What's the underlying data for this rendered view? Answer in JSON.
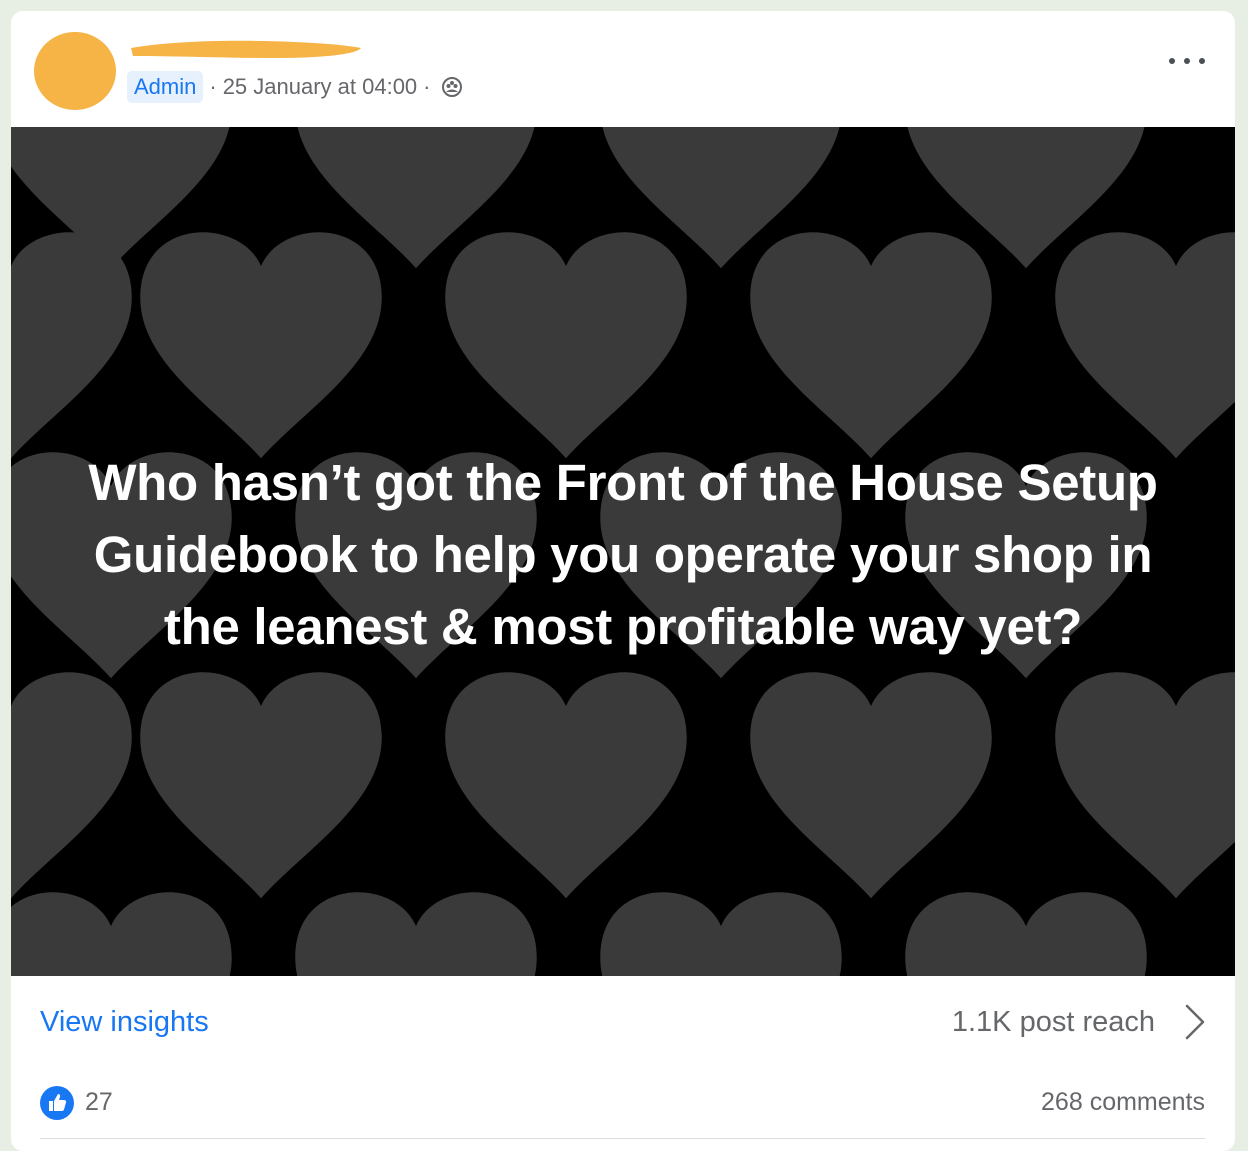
{
  "post": {
    "role_badge": "Admin",
    "date_separator": "·",
    "timestamp": "25 January at 04:00",
    "privacy_separator": "·",
    "privacy_icon": "group-icon",
    "more_icon": "more-horizontal-icon",
    "image_text": "Who hasn’t got the Front of the House Setup Guidebook to help you operate your shop in the leanest & most profitable way yet?"
  },
  "colors": {
    "avatar": "#f7b446",
    "accent": "#1877f2",
    "image_background": "#000000",
    "heart": "#3a3a3a"
  },
  "insights": {
    "view_insights_label": "View insights",
    "reach_label": "1.1K post reach",
    "chevron_icon": "chevron-right-icon"
  },
  "engagement": {
    "like_icon": "like-icon",
    "like_count": "27",
    "comments_label": "268 comments"
  }
}
